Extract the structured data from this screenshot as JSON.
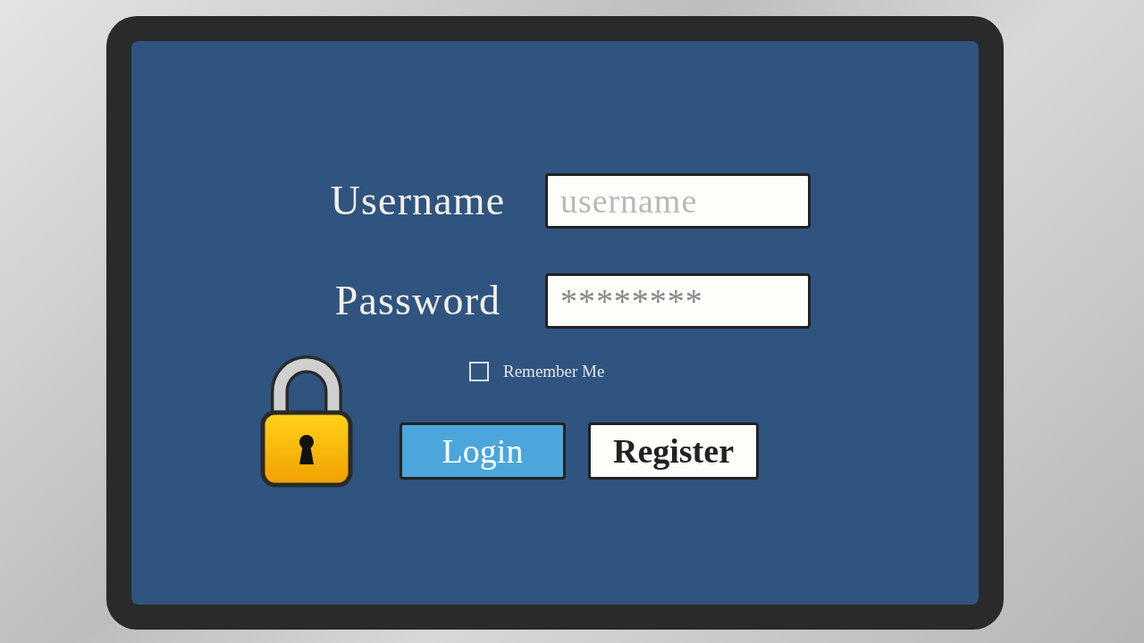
{
  "login_form": {
    "fields": [
      {
        "label": "Username",
        "placeholder": "username"
      },
      {
        "label": "Password",
        "value": "********"
      }
    ],
    "remember_me": {
      "label": "Remember Me",
      "checked": false
    },
    "buttons": [
      {
        "label": "Login",
        "kind": "primary"
      },
      {
        "label": "Register",
        "kind": "secondary"
      }
    ]
  }
}
